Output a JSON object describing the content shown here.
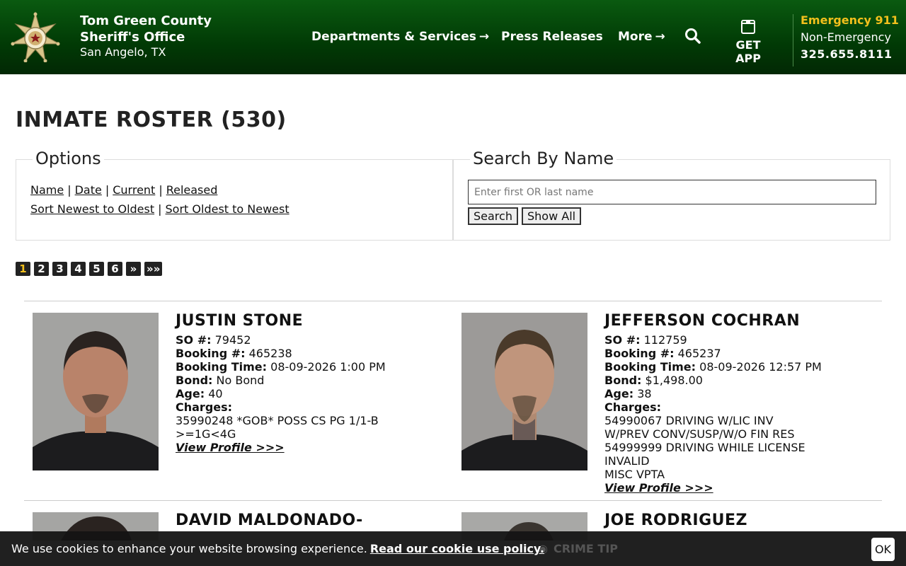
{
  "header": {
    "name": "Tom Green County Sheriff's Office",
    "city": "San Angelo, TX",
    "nav": [
      {
        "label": "Departments & Services",
        "arrow": "→"
      },
      {
        "label": "Press Releases"
      },
      {
        "label": "More",
        "arrow": "→"
      }
    ],
    "get_app": "GET APP",
    "emergency": "Emergency 911",
    "non_emergency": "Non-Emergency",
    "phone": "325.655.8111"
  },
  "page": {
    "title": "INMATE ROSTER (530)"
  },
  "options": {
    "legend": "Options",
    "filters": [
      "Name",
      "Date",
      "Current",
      "Released"
    ],
    "sorts": [
      "Sort Newest to Oldest",
      "Sort Oldest to Newest"
    ],
    "separator": "|"
  },
  "search": {
    "legend": "Search By Name",
    "placeholder": "Enter first OR last name",
    "value": "",
    "search_label": "Search",
    "show_all_label": "Show All"
  },
  "pagination": {
    "pages": [
      "1",
      "2",
      "3",
      "4",
      "5",
      "6",
      "»",
      "»»"
    ],
    "active": "1"
  },
  "inmates": [
    {
      "name": "JUSTIN STONE",
      "so_label": "SO #:",
      "so": "79452",
      "booking_label": "Booking #:",
      "booking": "465238",
      "time_label": "Booking Time:",
      "time": "08-09-2026 1:00 PM",
      "bond_label": "Bond:",
      "bond": "No Bond",
      "age_label": "Age:",
      "age": "40",
      "charges_label": "Charges:",
      "charges": [
        "35990248 *GOB* POSS CS PG 1/1-B",
        ">=1G<4G"
      ],
      "view": "View Profile >>>"
    },
    {
      "name": "JEFFERSON COCHRAN",
      "so_label": "SO #:",
      "so": "112759",
      "booking_label": "Booking #:",
      "booking": "465237",
      "time_label": "Booking Time:",
      "time": "08-09-2026 12:57 PM",
      "bond_label": "Bond:",
      "bond": "$1,498.00",
      "age_label": "Age:",
      "age": "38",
      "charges_label": "Charges:",
      "charges": [
        "54990067 DRIVING W/LIC INV",
        "W/PREV CONV/SUSP/W/O FIN RES",
        "54999999 DRIVING WHILE LICENSE",
        "INVALID",
        "MISC VPTA"
      ],
      "view": "View Profile >>>"
    },
    {
      "name": "DAVID MALDONADO-"
    },
    {
      "name": "JOE RODRIGUEZ"
    }
  ],
  "cookie": {
    "text": "We use cookies to enhance your website browsing experience.",
    "link": "Read our cookie use policy.",
    "ok": "OK",
    "behind": "CRIME TIP"
  },
  "colors": {
    "header_green": "#013a05",
    "accent_yellow": "#f2c01c"
  }
}
